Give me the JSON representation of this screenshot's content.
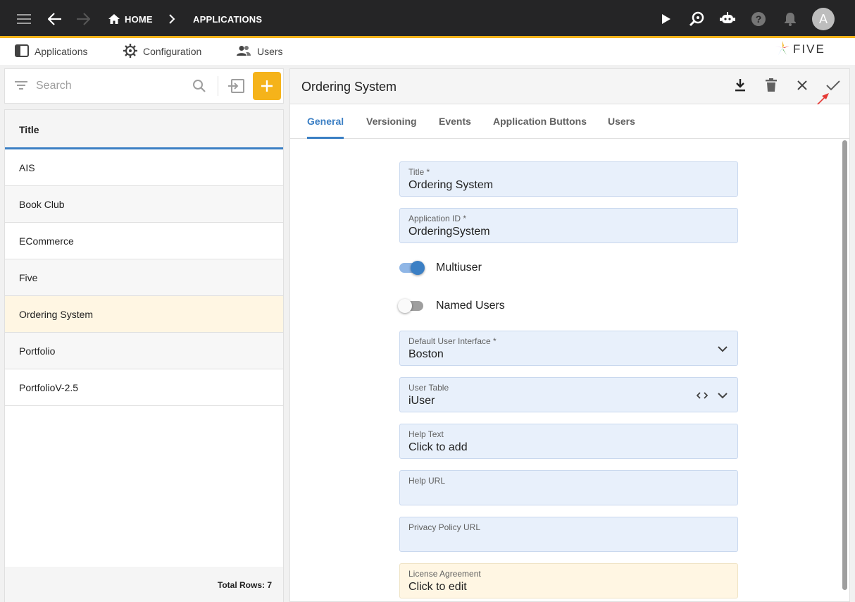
{
  "topbar": {
    "breadcrumb_home": "HOME",
    "breadcrumb_current": "APPLICATIONS",
    "avatar_letter": "A",
    "accent_color": "#f5b31a"
  },
  "menu": {
    "applications": "Applications",
    "configuration": "Configuration",
    "users": "Users",
    "logo_text": "FIVE"
  },
  "list": {
    "search_placeholder": "Search",
    "column_title": "Title",
    "rows": [
      "AIS",
      "Book Club",
      "ECommerce",
      "Five",
      "Ordering System",
      "Portfolio",
      "PortfolioV-2.5"
    ],
    "selected_index": 4,
    "total_rows": "Total Rows: 7"
  },
  "form": {
    "title": "Ordering System",
    "tabs": [
      "General",
      "Versioning",
      "Events",
      "Application Buttons",
      "Users"
    ],
    "active_tab": "General",
    "fields": {
      "title": {
        "label": "Title *",
        "value": "Ordering System"
      },
      "app_id": {
        "label": "Application ID *",
        "value": "OrderingSystem"
      },
      "multiuser": {
        "label": "Multiuser",
        "on": true
      },
      "named_users": {
        "label": "Named Users",
        "on": false
      },
      "default_ui": {
        "label": "Default User Interface *",
        "value": "Boston"
      },
      "user_table": {
        "label": "User Table",
        "value": "iUser"
      },
      "help_text": {
        "label": "Help Text",
        "value": "Click to add"
      },
      "help_url": {
        "label": "Help URL",
        "value": ""
      },
      "privacy_url": {
        "label": "Privacy Policy URL",
        "value": ""
      },
      "license": {
        "label": "License Agreement",
        "value": "Click to edit"
      }
    }
  }
}
